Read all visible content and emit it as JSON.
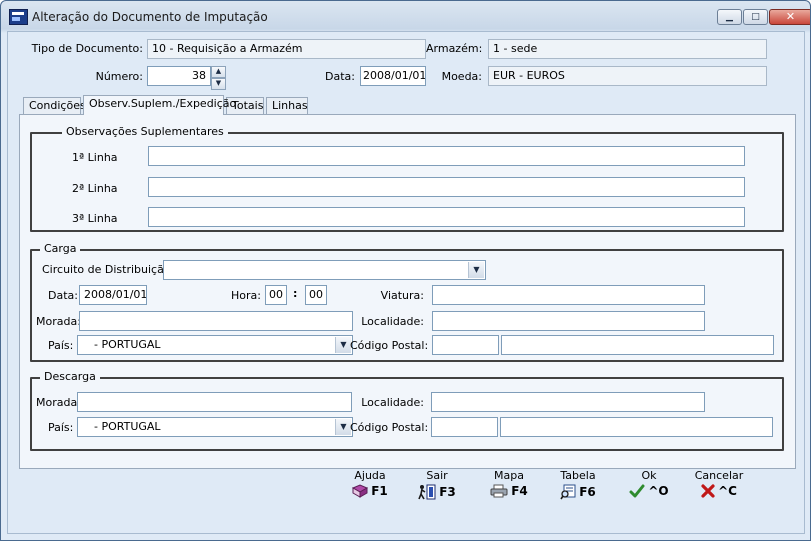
{
  "window": {
    "title": "Alteração do Documento de Imputação"
  },
  "header": {
    "tipo_documento_label": "Tipo de Documento:",
    "tipo_documento_value": "10 - Requisição a Armazém",
    "armazem_label": "Armazém:",
    "armazem_value": "1 - sede",
    "numero_label": "Número:",
    "numero_value": "38",
    "data_label": "Data:",
    "data_value": "2008/01/01",
    "moeda_label": "Moeda:",
    "moeda_value": "EUR - EUROS"
  },
  "tabs": [
    "Condições",
    "Observ.Suplem./Expedição",
    "Totais",
    "Linhas"
  ],
  "active_tab": "Observ.Suplem./Expedição",
  "observacoes": {
    "title": "Observações Suplementares",
    "linha1_label": "1ª Linha",
    "linha2_label": "2ª Linha",
    "linha3_label": "3ª Linha",
    "linha1_value": "",
    "linha2_value": "",
    "linha3_value": ""
  },
  "carga": {
    "title": "Carga",
    "circuito_label": "Circuito de Distribuição:",
    "circuito_value": "",
    "data_label": "Data:",
    "data_value": "2008/01/01",
    "hora_label": "Hora:",
    "hora_h": "00",
    "hora_sep": ":",
    "hora_m": "00",
    "viatura_label": "Viatura:",
    "viatura_value": "",
    "morada_label": "Morada:",
    "morada_value": "",
    "localidade_label": "Localidade:",
    "localidade_value": "",
    "pais_label": "País:",
    "pais_value": "- PORTUGAL",
    "codigo_postal_label": "Código Postal:",
    "codigo_postal_1": "",
    "codigo_postal_2": ""
  },
  "descarga": {
    "title": "Descarga",
    "morada_label": "Morada:",
    "morada_value": "",
    "localidade_label": "Localidade:",
    "localidade_value": "",
    "pais_label": "País:",
    "pais_value": "- PORTUGAL",
    "codigo_postal_label": "Código Postal:",
    "codigo_postal_1": "",
    "codigo_postal_2": ""
  },
  "footer": {
    "ajuda": {
      "label": "Ajuda",
      "key": "F1",
      "icon": "book-icon"
    },
    "sair": {
      "label": "Sair",
      "key": "F3",
      "icon": "exit-door-icon"
    },
    "mapa": {
      "label": "Mapa",
      "key": "F4",
      "icon": "printer-icon"
    },
    "tabela": {
      "label": "Tabela",
      "key": "F6",
      "icon": "search-table-icon"
    },
    "ok": {
      "label": "Ok",
      "key": "^O",
      "icon": "checkmark-icon"
    },
    "cancelar": {
      "label": "Cancelar",
      "key": "^C",
      "icon": "red-x-icon"
    }
  },
  "colors": {
    "accent": "#dfeaf6",
    "ok_green": "#2e8b2e",
    "cancel_red": "#c01818"
  }
}
